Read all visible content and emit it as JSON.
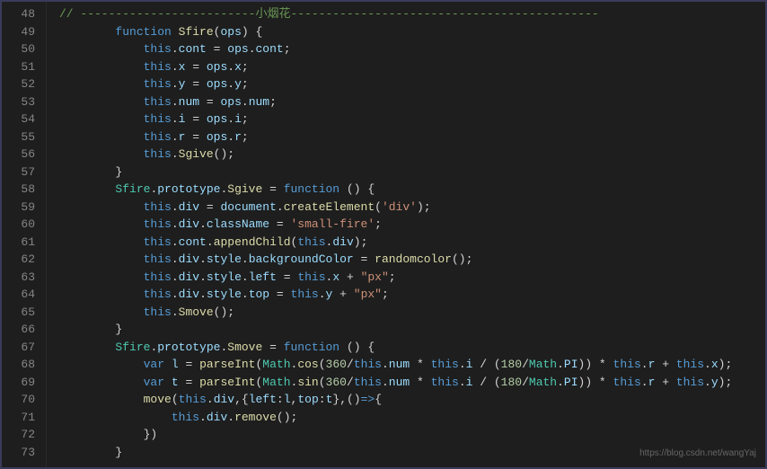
{
  "watermark": "https://blog.csdn.net/wangYaj",
  "lines": [
    {
      "num": "48",
      "tokens": [
        [
          "c-comment",
          "// -------------------------"
        ],
        [
          "c-chinese",
          "小烟花"
        ],
        [
          "c-comment",
          "--------------------------------------------"
        ]
      ]
    },
    {
      "num": "49",
      "indent": "        ",
      "tokens": [
        [
          "c-keyword",
          "function"
        ],
        [
          "",
          " "
        ],
        [
          "c-funcname",
          "Sfire"
        ],
        [
          "",
          "("
        ],
        [
          "c-param",
          "ops"
        ],
        [
          "",
          ") {"
        ]
      ]
    },
    {
      "num": "50",
      "indent": "            ",
      "tokens": [
        [
          "c-this",
          "this"
        ],
        [
          "",
          "."
        ],
        [
          "c-prop",
          "cont"
        ],
        [
          "",
          " = "
        ],
        [
          "c-param",
          "ops"
        ],
        [
          "",
          "."
        ],
        [
          "c-prop",
          "cont"
        ],
        [
          "",
          ";"
        ]
      ]
    },
    {
      "num": "51",
      "indent": "            ",
      "tokens": [
        [
          "c-this",
          "this"
        ],
        [
          "",
          "."
        ],
        [
          "c-prop",
          "x"
        ],
        [
          "",
          " = "
        ],
        [
          "c-param",
          "ops"
        ],
        [
          "",
          "."
        ],
        [
          "c-prop",
          "x"
        ],
        [
          "",
          ";"
        ]
      ]
    },
    {
      "num": "52",
      "indent": "            ",
      "tokens": [
        [
          "c-this",
          "this"
        ],
        [
          "",
          "."
        ],
        [
          "c-prop",
          "y"
        ],
        [
          "",
          " = "
        ],
        [
          "c-param",
          "ops"
        ],
        [
          "",
          "."
        ],
        [
          "c-prop",
          "y"
        ],
        [
          "",
          ";"
        ]
      ]
    },
    {
      "num": "53",
      "indent": "            ",
      "tokens": [
        [
          "c-this",
          "this"
        ],
        [
          "",
          "."
        ],
        [
          "c-prop",
          "num"
        ],
        [
          "",
          " = "
        ],
        [
          "c-param",
          "ops"
        ],
        [
          "",
          "."
        ],
        [
          "c-prop",
          "num"
        ],
        [
          "",
          ";"
        ]
      ]
    },
    {
      "num": "54",
      "indent": "            ",
      "tokens": [
        [
          "c-this",
          "this"
        ],
        [
          "",
          "."
        ],
        [
          "c-prop",
          "i"
        ],
        [
          "",
          " = "
        ],
        [
          "c-param",
          "ops"
        ],
        [
          "",
          "."
        ],
        [
          "c-prop",
          "i"
        ],
        [
          "",
          ";"
        ]
      ]
    },
    {
      "num": "55",
      "indent": "            ",
      "tokens": [
        [
          "c-this",
          "this"
        ],
        [
          "",
          "."
        ],
        [
          "c-prop",
          "r"
        ],
        [
          "",
          " = "
        ],
        [
          "c-param",
          "ops"
        ],
        [
          "",
          "."
        ],
        [
          "c-prop",
          "r"
        ],
        [
          "",
          ";"
        ]
      ]
    },
    {
      "num": "56",
      "indent": "            ",
      "tokens": [
        [
          "c-this",
          "this"
        ],
        [
          "",
          "."
        ],
        [
          "c-funcname",
          "Sgive"
        ],
        [
          "",
          "();"
        ]
      ]
    },
    {
      "num": "57",
      "indent": "        ",
      "tokens": [
        [
          "",
          "}"
        ]
      ]
    },
    {
      "num": "58",
      "indent": "        ",
      "tokens": [
        [
          "c-obj",
          "Sfire"
        ],
        [
          "",
          "."
        ],
        [
          "c-prop",
          "prototype"
        ],
        [
          "",
          "."
        ],
        [
          "c-funcname",
          "Sgive"
        ],
        [
          "",
          " = "
        ],
        [
          "c-keyword",
          "function"
        ],
        [
          "",
          " () {"
        ]
      ]
    },
    {
      "num": "59",
      "indent": "            ",
      "tokens": [
        [
          "c-this",
          "this"
        ],
        [
          "",
          "."
        ],
        [
          "c-prop",
          "div"
        ],
        [
          "",
          " = "
        ],
        [
          "c-param",
          "document"
        ],
        [
          "",
          "."
        ],
        [
          "c-funcname",
          "createElement"
        ],
        [
          "",
          "("
        ],
        [
          "c-string",
          "'div'"
        ],
        [
          "",
          ");"
        ]
      ]
    },
    {
      "num": "60",
      "indent": "            ",
      "tokens": [
        [
          "c-this",
          "this"
        ],
        [
          "",
          "."
        ],
        [
          "c-prop",
          "div"
        ],
        [
          "",
          "."
        ],
        [
          "c-prop",
          "className"
        ],
        [
          "",
          " = "
        ],
        [
          "c-string",
          "'small-fire'"
        ],
        [
          "",
          ";"
        ]
      ]
    },
    {
      "num": "61",
      "indent": "            ",
      "tokens": [
        [
          "c-this",
          "this"
        ],
        [
          "",
          "."
        ],
        [
          "c-prop",
          "cont"
        ],
        [
          "",
          "."
        ],
        [
          "c-funcname",
          "appendChild"
        ],
        [
          "",
          "("
        ],
        [
          "c-this",
          "this"
        ],
        [
          "",
          "."
        ],
        [
          "c-prop",
          "div"
        ],
        [
          "",
          ");"
        ]
      ]
    },
    {
      "num": "62",
      "indent": "            ",
      "tokens": [
        [
          "c-this",
          "this"
        ],
        [
          "",
          "."
        ],
        [
          "c-prop",
          "div"
        ],
        [
          "",
          "."
        ],
        [
          "c-prop",
          "style"
        ],
        [
          "",
          "."
        ],
        [
          "c-prop",
          "backgroundColor"
        ],
        [
          "",
          " = "
        ],
        [
          "c-funcname",
          "randomcolor"
        ],
        [
          "",
          "();"
        ]
      ]
    },
    {
      "num": "63",
      "indent": "            ",
      "tokens": [
        [
          "c-this",
          "this"
        ],
        [
          "",
          "."
        ],
        [
          "c-prop",
          "div"
        ],
        [
          "",
          "."
        ],
        [
          "c-prop",
          "style"
        ],
        [
          "",
          "."
        ],
        [
          "c-prop",
          "left"
        ],
        [
          "",
          " = "
        ],
        [
          "c-this",
          "this"
        ],
        [
          "",
          "."
        ],
        [
          "c-prop",
          "x"
        ],
        [
          "",
          " + "
        ],
        [
          "c-string",
          "\"px\""
        ],
        [
          "",
          ";"
        ]
      ]
    },
    {
      "num": "64",
      "indent": "            ",
      "tokens": [
        [
          "c-this",
          "this"
        ],
        [
          "",
          "."
        ],
        [
          "c-prop",
          "div"
        ],
        [
          "",
          "."
        ],
        [
          "c-prop",
          "style"
        ],
        [
          "",
          "."
        ],
        [
          "c-prop",
          "top"
        ],
        [
          "",
          " = "
        ],
        [
          "c-this",
          "this"
        ],
        [
          "",
          "."
        ],
        [
          "c-prop",
          "y"
        ],
        [
          "",
          " + "
        ],
        [
          "c-string",
          "\"px\""
        ],
        [
          "",
          ";"
        ]
      ]
    },
    {
      "num": "65",
      "indent": "            ",
      "tokens": [
        [
          "c-this",
          "this"
        ],
        [
          "",
          "."
        ],
        [
          "c-funcname",
          "Smove"
        ],
        [
          "",
          "();"
        ]
      ]
    },
    {
      "num": "66",
      "indent": "        ",
      "tokens": [
        [
          "",
          "}"
        ]
      ]
    },
    {
      "num": "67",
      "indent": "        ",
      "tokens": [
        [
          "c-obj",
          "Sfire"
        ],
        [
          "",
          "."
        ],
        [
          "c-prop",
          "prototype"
        ],
        [
          "",
          "."
        ],
        [
          "c-funcname",
          "Smove"
        ],
        [
          "",
          " = "
        ],
        [
          "c-keyword",
          "function"
        ],
        [
          "",
          " () {"
        ]
      ]
    },
    {
      "num": "68",
      "indent": "            ",
      "tokens": [
        [
          "c-keyword",
          "var"
        ],
        [
          "",
          " "
        ],
        [
          "c-prop",
          "l"
        ],
        [
          "",
          " = "
        ],
        [
          "c-funcname",
          "parseInt"
        ],
        [
          "",
          "("
        ],
        [
          "c-obj",
          "Math"
        ],
        [
          "",
          "."
        ],
        [
          "c-funcname",
          "cos"
        ],
        [
          "",
          "("
        ],
        [
          "c-num",
          "360"
        ],
        [
          "",
          "/"
        ],
        [
          "c-this",
          "this"
        ],
        [
          "",
          "."
        ],
        [
          "c-prop",
          "num"
        ],
        [
          "",
          " * "
        ],
        [
          "c-this",
          "this"
        ],
        [
          "",
          "."
        ],
        [
          "c-prop",
          "i"
        ],
        [
          "",
          " / ("
        ],
        [
          "c-num",
          "180"
        ],
        [
          "",
          "/"
        ],
        [
          "c-obj",
          "Math"
        ],
        [
          "",
          "."
        ],
        [
          "c-prop",
          "PI"
        ],
        [
          "",
          ")) * "
        ],
        [
          "c-this",
          "this"
        ],
        [
          "",
          "."
        ],
        [
          "c-prop",
          "r"
        ],
        [
          "",
          " + "
        ],
        [
          "c-this",
          "this"
        ],
        [
          "",
          "."
        ],
        [
          "c-prop",
          "x"
        ],
        [
          "",
          ");"
        ]
      ]
    },
    {
      "num": "69",
      "indent": "            ",
      "tokens": [
        [
          "c-keyword",
          "var"
        ],
        [
          "",
          " "
        ],
        [
          "c-prop",
          "t"
        ],
        [
          "",
          " = "
        ],
        [
          "c-funcname",
          "parseInt"
        ],
        [
          "",
          "("
        ],
        [
          "c-obj",
          "Math"
        ],
        [
          "",
          "."
        ],
        [
          "c-funcname",
          "sin"
        ],
        [
          "",
          "("
        ],
        [
          "c-num",
          "360"
        ],
        [
          "",
          "/"
        ],
        [
          "c-this",
          "this"
        ],
        [
          "",
          "."
        ],
        [
          "c-prop",
          "num"
        ],
        [
          "",
          " * "
        ],
        [
          "c-this",
          "this"
        ],
        [
          "",
          "."
        ],
        [
          "c-prop",
          "i"
        ],
        [
          "",
          " / ("
        ],
        [
          "c-num",
          "180"
        ],
        [
          "",
          "/"
        ],
        [
          "c-obj",
          "Math"
        ],
        [
          "",
          "."
        ],
        [
          "c-prop",
          "PI"
        ],
        [
          "",
          ")) * "
        ],
        [
          "c-this",
          "this"
        ],
        [
          "",
          "."
        ],
        [
          "c-prop",
          "r"
        ],
        [
          "",
          " + "
        ],
        [
          "c-this",
          "this"
        ],
        [
          "",
          "."
        ],
        [
          "c-prop",
          "y"
        ],
        [
          "",
          ");"
        ]
      ]
    },
    {
      "num": "70",
      "indent": "            ",
      "tokens": [
        [
          "c-funcname",
          "move"
        ],
        [
          "",
          "("
        ],
        [
          "c-this",
          "this"
        ],
        [
          "",
          "."
        ],
        [
          "c-prop",
          "div"
        ],
        [
          "",
          ",{"
        ],
        [
          "c-prop",
          "left"
        ],
        [
          "",
          ":"
        ],
        [
          "c-prop",
          "l"
        ],
        [
          "",
          ","
        ],
        [
          "c-prop",
          "top"
        ],
        [
          "",
          ":"
        ],
        [
          "c-prop",
          "t"
        ],
        [
          "",
          "},()"
        ],
        [
          "c-keyword",
          "=>"
        ],
        [
          "",
          "{"
        ]
      ]
    },
    {
      "num": "71",
      "indent": "                ",
      "tokens": [
        [
          "c-this",
          "this"
        ],
        [
          "",
          "."
        ],
        [
          "c-prop",
          "div"
        ],
        [
          "",
          "."
        ],
        [
          "c-funcname",
          "remove"
        ],
        [
          "",
          "();"
        ]
      ]
    },
    {
      "num": "72",
      "indent": "            ",
      "tokens": [
        [
          "",
          "})"
        ]
      ]
    },
    {
      "num": "73",
      "indent": "        ",
      "tokens": [
        [
          "",
          "}"
        ]
      ]
    }
  ]
}
